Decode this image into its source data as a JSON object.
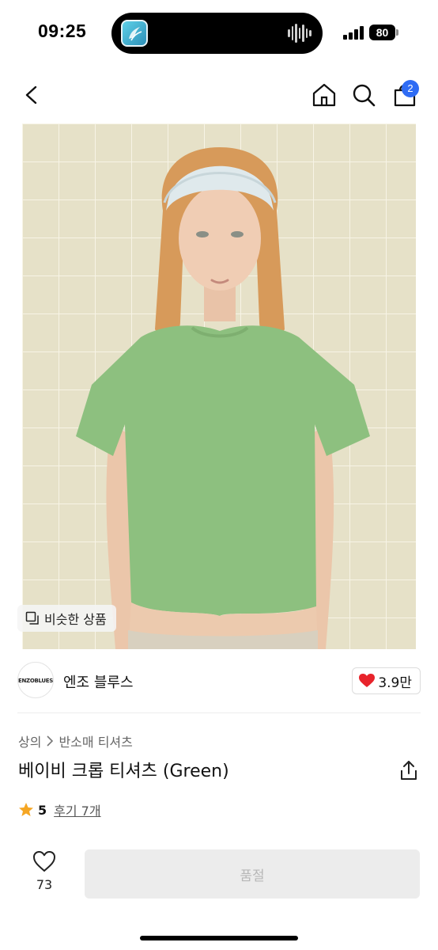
{
  "status_bar": {
    "time": "09:25",
    "battery": "80"
  },
  "nav": {
    "cart_count": "2"
  },
  "image_overlay": {
    "similar_label": "비슷한 상품"
  },
  "brand": {
    "logo_text": "ENZOBLUES",
    "name": "엔조 블루스",
    "likes": "3.9만"
  },
  "breadcrumb": {
    "category": "상의",
    "subcategory": "반소매 티셔츠"
  },
  "product": {
    "title": "베이비 크롭 티셔츠 (Green)",
    "rating": "5",
    "reviews_label": "후기 7개"
  },
  "bottom_bar": {
    "wish_count": "73",
    "action_label": "품절"
  },
  "colors": {
    "accent_blue": "#2f6cf4",
    "heart_red": "#e8232b",
    "star_orange": "#f5a623",
    "tshirt_green": "#8dc07f"
  },
  "icons": [
    "back-arrow-icon",
    "home-icon",
    "search-icon",
    "shopping-bag-icon",
    "similar-items-icon",
    "heart-icon",
    "share-icon",
    "star-icon",
    "heart-outline-icon"
  ]
}
